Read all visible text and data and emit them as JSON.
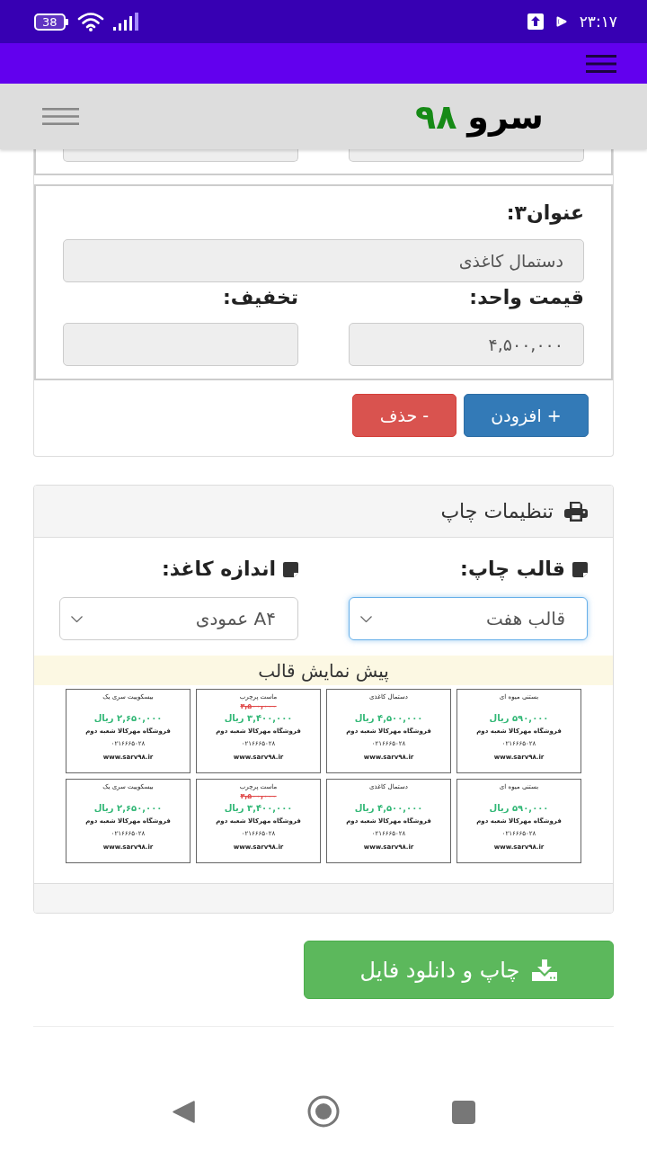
{
  "status_bar": {
    "time": "۲۳:۱۷",
    "battery": "38"
  },
  "header": {
    "logo_word": "سرو",
    "logo_number": "۹۸"
  },
  "item": {
    "title_label": "عنوان۳:",
    "title_value": "دستمال کاغذی",
    "fields": [
      {
        "label": "قیمت واحد:",
        "value": "۴,۵۰۰,۰۰۰"
      },
      {
        "label": "تخفیف:"
      }
    ]
  },
  "actions": [
    {
      "kind": "add",
      "label": "+ افزودن"
    },
    {
      "kind": "remove",
      "label": "- حذف"
    }
  ],
  "print_settings": {
    "title": "تنظیمات چاپ",
    "selects": [
      {
        "label": "قالب چاپ:",
        "value": "قالب هفت",
        "focused": true
      },
      {
        "label": "اندازه کاغذ:",
        "value": "A۴ عمودی",
        "focused": false
      }
    ],
    "preview_title": "پیش نمایش قالب",
    "labels": [
      {
        "name": "بستنی میوه ای",
        "price": "۵۹۰,۰۰۰ ریال",
        "store": "فروشگاه مهرکالا شعبه دوم",
        "phone": "۰۲۱۶۶۶۵۰۲۸",
        "website": "www.sarv۹۸.ir"
      },
      {
        "name": "دستمال کاغذی",
        "price": "۴,۵۰۰,۰۰۰ ریال",
        "store": "فروشگاه مهرکالا شعبه دوم",
        "phone": "۰۲۱۶۶۶۵۰۲۸",
        "website": "www.sarv۹۸.ir"
      },
      {
        "name": "ماست پرچرب",
        "old_price": "۳,۵۰۰,۰۰۰",
        "price": "۳,۴۰۰,۰۰۰ ریال",
        "store": "فروشگاه مهرکالا شعبه دوم",
        "phone": "۰۲۱۶۶۶۵۰۲۸",
        "website": "www.sarv۹۸.ir"
      },
      {
        "name": "بیسکوییت سری یک",
        "price": "۲,۶۵۰,۰۰۰ ریال",
        "store": "فروشگاه مهرکالا شعبه دوم",
        "phone": "۰۲۱۶۶۶۵۰۲۸",
        "website": "www.sarv۹۸.ir"
      },
      {
        "name": "بستنی میوه ای",
        "price": "۵۹۰,۰۰۰ ریال",
        "store": "فروشگاه مهرکالا شعبه دوم",
        "phone": "۰۲۱۶۶۶۵۰۲۸",
        "website": "www.sarv۹۸.ir"
      },
      {
        "name": "دستمال کاغذی",
        "price": "۴,۵۰۰,۰۰۰ ریال",
        "store": "فروشگاه مهرکالا شعبه دوم",
        "phone": "۰۲۱۶۶۶۵۰۲۸",
        "website": "www.sarv۹۸.ir"
      },
      {
        "name": "ماست پرچرب",
        "old_price": "۳,۵۰۰,۰۰۰",
        "price": "۳,۴۰۰,۰۰۰ ریال",
        "store": "فروشگاه مهرکالا شعبه دوم",
        "phone": "۰۲۱۶۶۶۵۰۲۸",
        "website": "www.sarv۹۸.ir"
      },
      {
        "name": "بیسکوییت سری یک",
        "price": "۲,۶۵۰,۰۰۰ ریال",
        "store": "فروشگاه مهرکالا شعبه دوم",
        "phone": "۰۲۱۶۶۶۵۰۲۸",
        "website": "www.sarv۹۸.ir"
      }
    ]
  },
  "download_button": {
    "label": "چاپ و دانلود فایل"
  }
}
